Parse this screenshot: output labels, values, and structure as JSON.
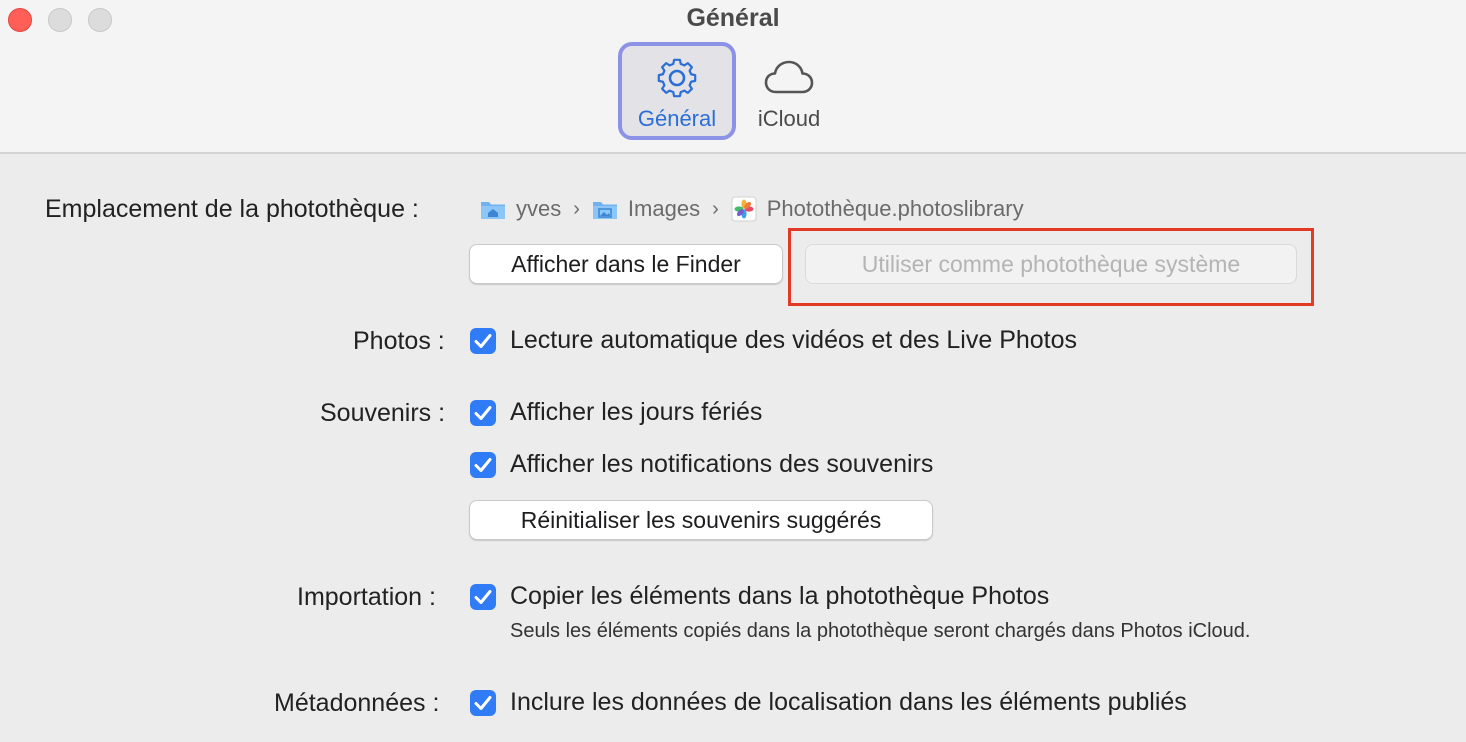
{
  "window": {
    "title": "Général",
    "traffic_lights": [
      "close",
      "minimize",
      "zoom"
    ]
  },
  "toolbar": {
    "tabs": [
      {
        "label": "Général",
        "icon": "gear-icon",
        "selected": true
      },
      {
        "label": "iCloud",
        "icon": "cloud-icon",
        "selected": false
      }
    ]
  },
  "library": {
    "label": "Emplacement de la photothèque :",
    "path": [
      {
        "name": "yves",
        "icon": "home-folder-icon"
      },
      {
        "name": "Images",
        "icon": "pictures-folder-icon"
      },
      {
        "name": "Photothèque.photoslibrary",
        "icon": "photos-library-icon"
      }
    ],
    "show_in_finder": "Afficher dans le Finder",
    "use_as_system_library": "Utiliser comme photothèque système"
  },
  "photos": {
    "label": "Photos :",
    "autoplay": {
      "text": "Lecture automatique des vidéos et des Live Photos",
      "checked": true
    }
  },
  "memories": {
    "label": "Souvenirs :",
    "holidays": {
      "text": "Afficher les jours fériés",
      "checked": true
    },
    "notifications": {
      "text": "Afficher les notifications des souvenirs",
      "checked": true
    },
    "reset_button": "Réinitialiser les souvenirs suggérés"
  },
  "importing": {
    "label": "Importation :",
    "copy": {
      "text": "Copier les éléments dans la photothèque Photos",
      "checked": true
    },
    "hint": "Seuls les éléments copiés dans la photothèque seront chargés dans Photos iCloud."
  },
  "metadata": {
    "label": "Métadonnées :",
    "location": {
      "text": "Inclure les données de localisation dans les éléments publiés",
      "checked": true
    }
  },
  "colors": {
    "accent": "#2f7cf6",
    "selected_tab_border": "#8c93e6",
    "highlight": "#e23a24"
  }
}
